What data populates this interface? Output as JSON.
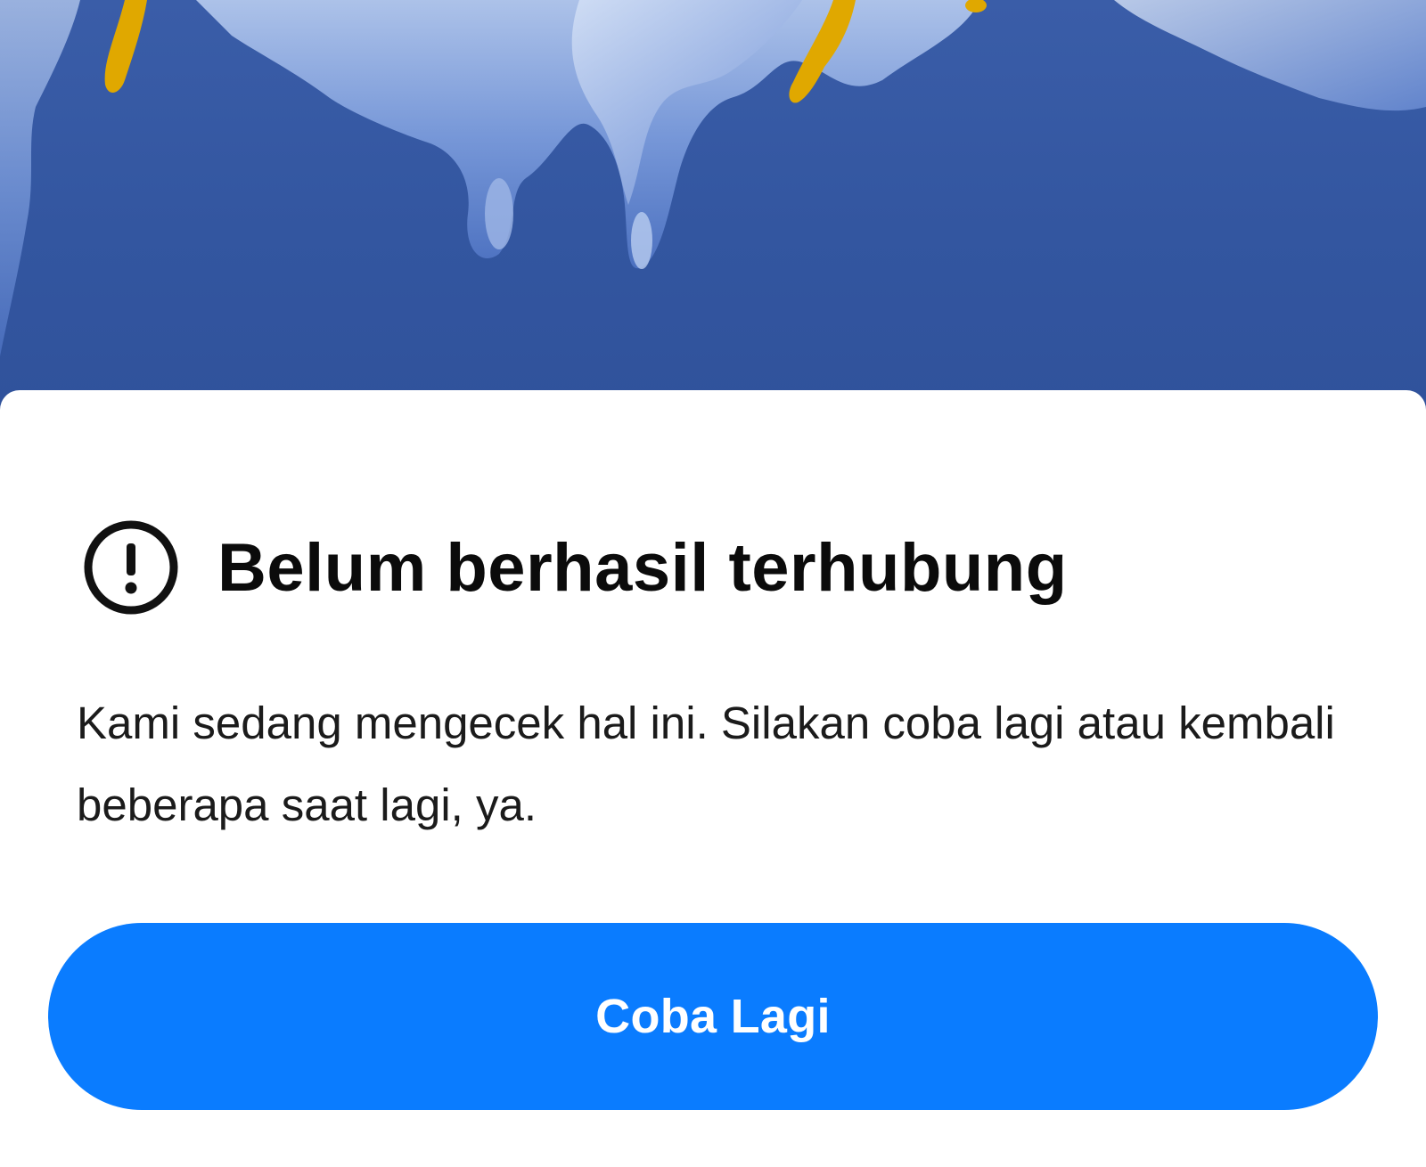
{
  "hero": {
    "illustration": "blue-liquid-splash-illustration",
    "background_color": "#3356a0"
  },
  "error": {
    "icon": "alert-circle-icon",
    "title": "Belum berhasil terhubung",
    "message": "Kami sedang mengecek hal ini. Silakan coba lagi atau kembali beberapa saat lagi, ya."
  },
  "actions": {
    "retry_label": "Coba Lagi",
    "retry_color": "#0a7cff"
  }
}
